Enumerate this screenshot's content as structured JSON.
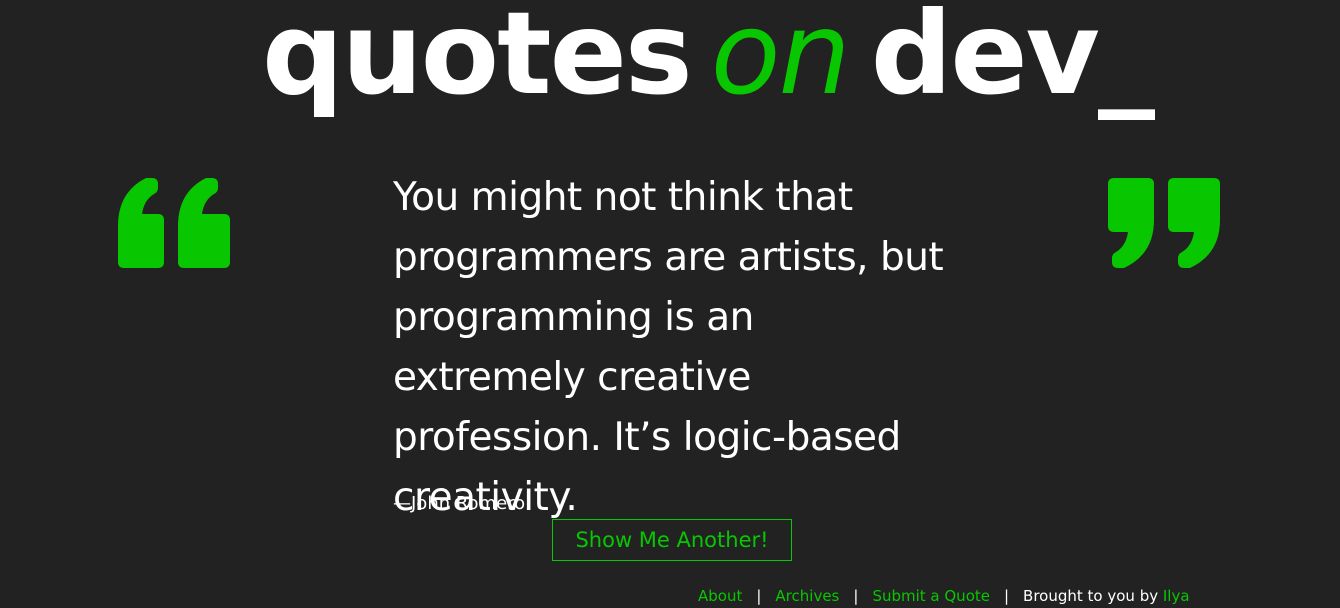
{
  "colors": {
    "background": "#222222",
    "accent": "#08c700",
    "text": "#ffffff"
  },
  "header": {
    "logo": {
      "word1": "quotes",
      "word2": "on",
      "word3": "dev_"
    }
  },
  "quote": {
    "open_mark_icon": "open-quote-icon",
    "close_mark_icon": "close-quote-icon",
    "text": "You might not think that programmers are artists, but programming is an extremely creative profession. It’s logic-based creativity.",
    "author": "—John Romero"
  },
  "actions": {
    "show_another_label": "Show Me Another!"
  },
  "footer": {
    "links": [
      {
        "label": "About"
      },
      {
        "label": "Archives"
      },
      {
        "label": "Submit a Quote"
      }
    ],
    "separator": "|",
    "credit_prefix": "Brought to you by",
    "credit_name": "Ilya"
  }
}
